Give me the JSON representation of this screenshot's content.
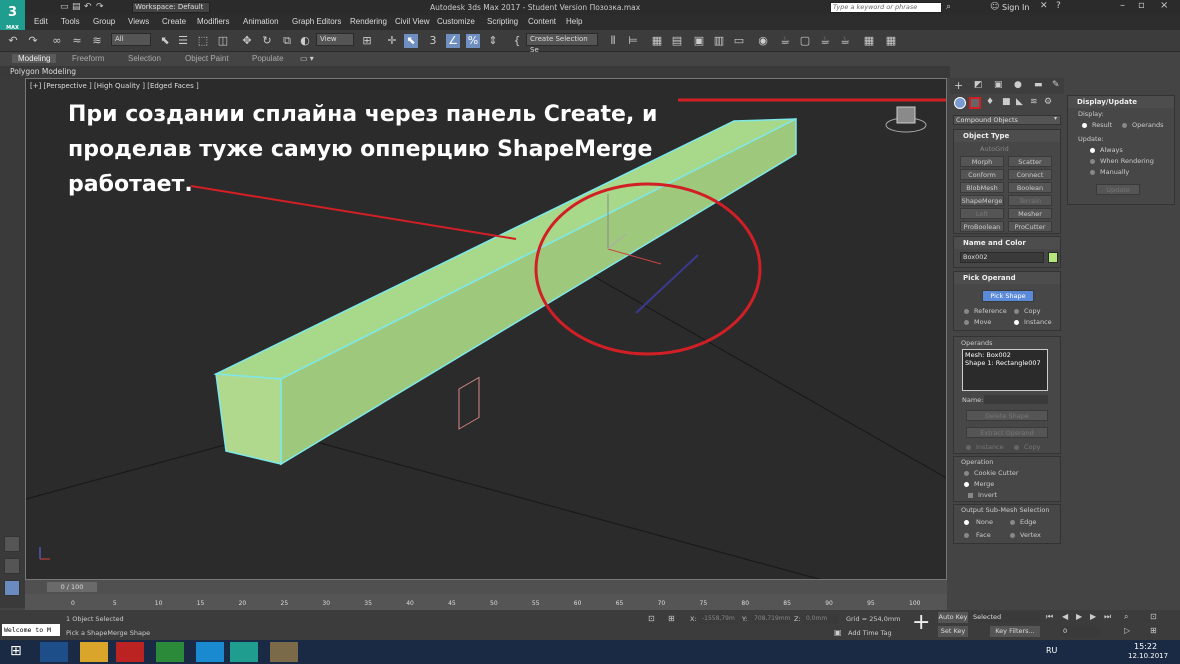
{
  "titlebar": {
    "title": "Autodesk 3ds Max 2017 - Student Version    Позозка.max",
    "workspace": "Workspace: Default",
    "search_placeholder": "Type a keyword or phrase",
    "signin": "Sign In"
  },
  "logo": {
    "label": "3",
    "sub": "MAX"
  },
  "menu": [
    "Edit",
    "Tools",
    "Group",
    "Views",
    "Create",
    "Modifiers",
    "Animation",
    "Graph Editors",
    "Rendering",
    "Civil View",
    "Customize",
    "Scripting",
    "Content",
    "Help"
  ],
  "toolbar": {
    "filter": "All",
    "coord": "View",
    "named_selection": "Create Selection Se"
  },
  "ribbon": {
    "tabs": [
      "Modeling",
      "Freeform",
      "Selection",
      "Object Paint",
      "Populate"
    ],
    "sub": "Polygon Modeling"
  },
  "viewport": {
    "label": "[+] [Perspective ] [High Quality ] [Edged Faces ]",
    "overlay": [
      "При создании сплайна через панель Create, и",
      "проделав туже самую опперцию ShapeMerge",
      "работает."
    ]
  },
  "command_panel": {
    "category": "Compound Objects",
    "object_type": {
      "title": "Object Type",
      "autogrid": "AutoGrid",
      "buttons": [
        "Morph",
        "Scatter",
        "Conform",
        "Connect",
        "BlobMesh",
        "Boolean",
        "ShapeMerge",
        "Terrain",
        "Loft",
        "Mesher",
        "ProBoolean",
        "ProCutter"
      ]
    },
    "name_color": {
      "title": "Name and Color",
      "name": "Box002",
      "color": "#b4e87a"
    },
    "pick_operand": {
      "title": "Pick Operand",
      "button": "Pick Shape",
      "options": [
        "Reference",
        "Copy",
        "Move",
        "Instance"
      ]
    },
    "operands": {
      "title": "Operands",
      "items": [
        "Mesh: Box002",
        "Shape 1: Rectangle007"
      ],
      "name_label": "Name:",
      "delete": "Delete Shape",
      "extract": "Extract Operand",
      "instance": "Instance",
      "copy": "Copy"
    },
    "operation": {
      "title": "Operation",
      "options": [
        "Cookie Cutter",
        "Merge",
        "Invert"
      ]
    },
    "output": {
      "title": "Output Sub-Mesh Selection",
      "options": [
        "None",
        "Edge",
        "Face",
        "Vertex"
      ]
    }
  },
  "display_update": {
    "title": "Display/Update",
    "display": "Display:",
    "result": "Result",
    "operands": "Operands",
    "update": "Update:",
    "always": "Always",
    "when_rendering": "When Rendering",
    "manually": "Manually",
    "update_btn": "Update"
  },
  "timeline": {
    "frame": "0 / 100",
    "ticks": [
      "0",
      "5",
      "10",
      "15",
      "20",
      "25",
      "30",
      "35",
      "40",
      "45",
      "50",
      "55",
      "60",
      "65",
      "70",
      "75",
      "80",
      "85",
      "90",
      "95",
      "100"
    ]
  },
  "status": {
    "selected": "1 Object Selected",
    "prompt": "Pick a ShapeMerge Shape",
    "maxscript": "Welcome to M",
    "x_label": "X:",
    "x": "-1558,79m",
    "y_label": "Y:",
    "y": "708,719mm",
    "z_label": "Z:",
    "z": "0,0mm",
    "grid": "Grid = 254,0mm",
    "add_time_tag": "Add Time Tag",
    "auto_key": "Auto Key",
    "set_key": "Set Key",
    "selected_dd": "Selected",
    "key_filters": "Key Filters...",
    "frame_field": "0"
  },
  "taskbar": {
    "lang": "RU",
    "time": "15:22",
    "date": "12.10.2017"
  }
}
